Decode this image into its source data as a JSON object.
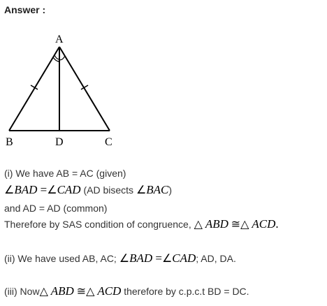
{
  "heading": "Answer :",
  "figure": {
    "vertices": {
      "A": "A",
      "B": "B",
      "C": "C",
      "D": "D"
    }
  },
  "part1": {
    "line1": "(i) We have AB = AC (given)",
    "line2_angle1": "BAD",
    "line2_eq": " =",
    "line2_angle2": "CAD",
    "line2_text": " (AD bisects ",
    "line2_angle3": "BAC",
    "line2_close": ")",
    "line3": "and AD = AD (common)",
    "line4_text": "Therefore by SAS condition of congruence, ",
    "line4_tri1": "ABD",
    "line4_cong": "≅",
    "line4_tri2": "ACD",
    "line4_end": "."
  },
  "part2": {
    "text1": "(ii) We have used AB, AC; ",
    "angle1": "BAD",
    "eq": " =",
    "angle2": "CAD",
    "text2": "; AD, DA."
  },
  "part3": {
    "text1": "(iii) Now",
    "tri1": "ABD",
    "cong": "≅",
    "tri2": "ACD",
    "text2": " therefore by c.p.c.t BD = DC."
  }
}
